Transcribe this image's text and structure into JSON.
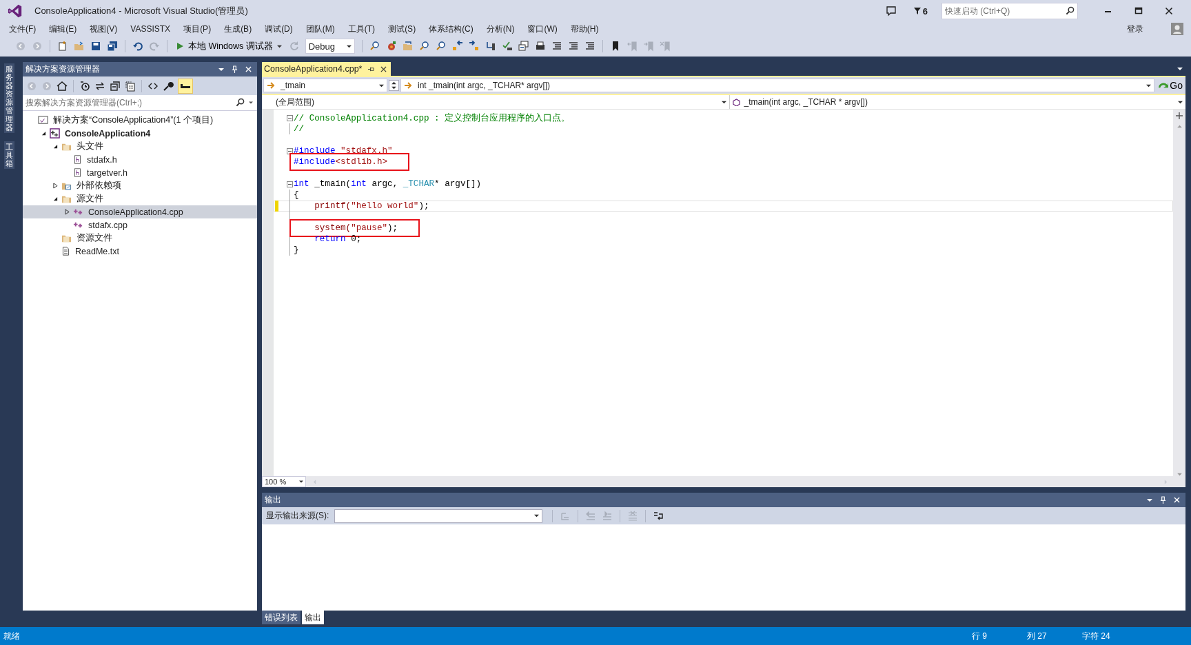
{
  "window": {
    "title": "ConsoleApplication4 - Microsoft Visual Studio(管理员)",
    "notification_count": "6",
    "quick_launch": {
      "placeholder": "快速启动 (Ctrl+Q)"
    },
    "sign_in": "登录"
  },
  "menu": [
    "文件(F)",
    "编辑(E)",
    "视图(V)",
    "VASSISTX",
    "项目(P)",
    "生成(B)",
    "调试(D)",
    "团队(M)",
    "工具(T)",
    "测试(S)",
    "体系结构(C)",
    "分析(N)",
    "窗口(W)",
    "帮助(H)"
  ],
  "toolbar": {
    "debugger": "本地 Windows 调试器",
    "configuration": "Debug"
  },
  "side_tabs": [
    "服务器资源管理器",
    "工具箱"
  ],
  "solution_explorer": {
    "title": "解决方案资源管理器",
    "search": {
      "placeholder": "搜索解决方案资源管理器(Ctrl+;)"
    },
    "tree": [
      {
        "label": "解决方案“ConsoleApplication4”(1 个项目)",
        "kind": "solution",
        "selected": false,
        "children": [
          {
            "label": "ConsoleApplication4",
            "kind": "project",
            "expanded": true,
            "selected": false,
            "children": [
              {
                "label": "头文件",
                "kind": "folder",
                "expanded": true,
                "selected": false,
                "children": [
                  {
                    "label": "stdafx.h",
                    "kind": "header",
                    "selected": false
                  },
                  {
                    "label": "targetver.h",
                    "kind": "header",
                    "selected": false
                  }
                ]
              },
              {
                "label": "外部依赖项",
                "kind": "references",
                "expanded": false,
                "selected": false
              },
              {
                "label": "源文件",
                "kind": "folder",
                "expanded": true,
                "selected": false,
                "children": [
                  {
                    "label": "ConsoleApplication4.cpp",
                    "kind": "source",
                    "expanded": false,
                    "selected": true
                  },
                  {
                    "label": "stdafx.cpp",
                    "kind": "source",
                    "selected": false
                  }
                ]
              },
              {
                "label": "资源文件",
                "kind": "folder",
                "selected": false
              },
              {
                "label": "ReadMe.txt",
                "kind": "text",
                "selected": false
              }
            ]
          }
        ]
      }
    ]
  },
  "editor": {
    "tabs": [
      {
        "label": "ConsoleApplication4.cpp*",
        "selected": true
      }
    ],
    "member_nav": "_tmain",
    "signature_nav": "int _tmain(int argc, _TCHAR* argv[])",
    "go": "Go",
    "scope": "(全局范围)",
    "function": "_tmain(int argc, _TCHAR * argv[])",
    "zoom": "100 %",
    "lines": [
      {
        "collapsible": true,
        "guide": false,
        "current": false,
        "changed": false,
        "boxed": false,
        "tokens": [
          {
            "kind": "comment",
            "text": "// ConsoleApplication4.cpp : 定义控制台应用程序的入口点。"
          }
        ]
      },
      {
        "collapsible": false,
        "guide": true,
        "current": false,
        "changed": false,
        "boxed": false,
        "tokens": [
          {
            "kind": "comment",
            "text": "//"
          }
        ]
      },
      {
        "collapsible": false,
        "guide": false,
        "current": false,
        "changed": false
      },
      {
        "collapsible": true,
        "guide": false,
        "current": false,
        "changed": false,
        "boxed": false,
        "tokens": [
          {
            "kind": "keyword",
            "text": "#include"
          },
          {
            "kind": "string",
            "text": " \"stdafx.h\""
          }
        ]
      },
      {
        "collapsible": false,
        "guide": true,
        "current": false,
        "changed": false,
        "boxed": true,
        "tokens": [
          {
            "kind": "keyword",
            "text": "#include"
          },
          {
            "kind": "string",
            "text": "<stdlib.h>"
          }
        ]
      },
      {
        "collapsible": false,
        "guide": false,
        "current": false,
        "changed": false
      },
      {
        "collapsible": true,
        "guide": false,
        "current": false,
        "changed": false,
        "boxed": false,
        "tokens": [
          {
            "kind": "keyword",
            "text": "int"
          },
          {
            "kind": "plain",
            "text": " _tmain("
          },
          {
            "kind": "keyword",
            "text": "int"
          },
          {
            "kind": "plain",
            "text": " argc, "
          },
          {
            "kind": "type",
            "text": "_TCHAR"
          },
          {
            "kind": "plain",
            "text": "* argv[])"
          }
        ]
      },
      {
        "collapsible": false,
        "guide": true,
        "current": false,
        "changed": false,
        "boxed": false,
        "tokens": [
          {
            "kind": "plain",
            "text": "{"
          }
        ]
      },
      {
        "collapsible": false,
        "guide": true,
        "current": true,
        "changed": true,
        "boxed": false,
        "tokens": [
          {
            "kind": "function",
            "text": "    printf("
          },
          {
            "kind": "string",
            "text": "\"hello world\""
          },
          {
            "kind": "plain",
            "text": ");"
          }
        ]
      },
      {
        "collapsible": false,
        "guide": true,
        "current": false,
        "changed": false
      },
      {
        "collapsible": false,
        "guide": true,
        "current": false,
        "changed": false,
        "boxed": true,
        "tokens": [
          {
            "kind": "function",
            "text": "    system("
          },
          {
            "kind": "string",
            "text": "\"pause\""
          },
          {
            "kind": "plain",
            "text": ");"
          }
        ]
      },
      {
        "collapsible": false,
        "guide": true,
        "current": false,
        "changed": false,
        "boxed": false,
        "tokens": [
          {
            "kind": "keyword",
            "text": "    return"
          },
          {
            "kind": "plain",
            "text": " 0;"
          }
        ]
      },
      {
        "collapsible": false,
        "guide": true,
        "current": false,
        "changed": false,
        "boxed": false,
        "tokens": [
          {
            "kind": "plain",
            "text": "}"
          }
        ]
      }
    ]
  },
  "output": {
    "title": "输出",
    "source_label": "显示输出来源(S):"
  },
  "bottom_tabs": [
    {
      "label": "错误列表",
      "selected": false
    },
    {
      "label": "输出",
      "selected": true
    }
  ],
  "status_bar": {
    "text": "就绪",
    "line": "行 9",
    "column": "列 27",
    "char": "字符 24"
  }
}
